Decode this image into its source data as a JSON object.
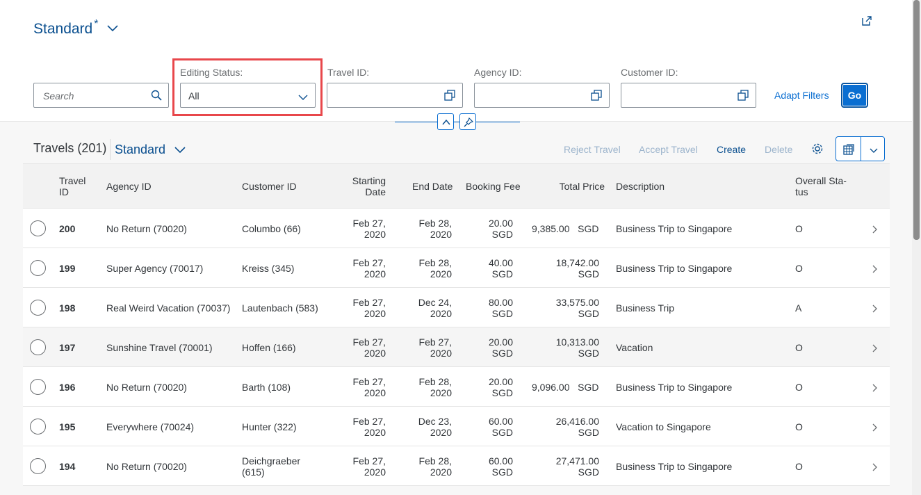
{
  "header": {
    "variant_title": "Standard",
    "variant_modified": "*",
    "search_placeholder": "Search",
    "filters": [
      {
        "label": "Editing Status:",
        "value": "All"
      },
      {
        "label": "Travel ID:",
        "value": ""
      },
      {
        "label": "Agency ID:",
        "value": ""
      },
      {
        "label": "Customer ID:",
        "value": ""
      }
    ],
    "adapt_filters": "Adapt Filters",
    "go": "Go"
  },
  "table": {
    "title": "Travels (201)",
    "variant": "Standard",
    "toolbar": {
      "reject": "Reject Travel",
      "accept": "Accept Travel",
      "create": "Create",
      "delete": "Delete"
    },
    "columns": {
      "travel_id": [
        "Travel",
        "ID"
      ],
      "agency_id": "Agency ID",
      "customer_id": "Customer ID",
      "start": [
        "Starting",
        "Date"
      ],
      "end": "End Date",
      "fee": "Booking Fee",
      "total": "Total Price",
      "desc": "Description",
      "status": [
        "Overall Sta-",
        "tus"
      ]
    },
    "rows": [
      {
        "id": "200",
        "agency": "No Return (70020)",
        "customer": [
          "Columbo (66)",
          ""
        ],
        "start": [
          "Feb 27,",
          "2020"
        ],
        "end": [
          "Feb 28,",
          "2020"
        ],
        "fee": [
          "20.00",
          "SGD"
        ],
        "total": [
          "9,385.00",
          "SGD"
        ],
        "desc": "Business Trip to Singapore",
        "status": "O"
      },
      {
        "id": "199",
        "agency": "Super Agency (70017)",
        "customer": [
          "Kreiss (345)",
          ""
        ],
        "start": [
          "Feb 27,",
          "2020"
        ],
        "end": [
          "Feb 28,",
          "2020"
        ],
        "fee": [
          "40.00",
          "SGD"
        ],
        "total": [
          "18,742.00",
          "SGD"
        ],
        "desc": "Business Trip to Singapore",
        "status": "O"
      },
      {
        "id": "198",
        "agency": "Real Weird Vacation (70037)",
        "customer": [
          "Lautenbach (583)",
          ""
        ],
        "start": [
          "Feb 27,",
          "2020"
        ],
        "end": [
          "Dec 24,",
          "2020"
        ],
        "fee": [
          "80.00",
          "SGD"
        ],
        "total": [
          "33,575.00",
          "SGD"
        ],
        "desc": "Business Trip",
        "status": "A"
      },
      {
        "id": "197",
        "agency": "Sunshine Travel (70001)",
        "customer": [
          "Hoffen (166)",
          ""
        ],
        "start": [
          "Feb 27,",
          "2020"
        ],
        "end": [
          "Feb 27,",
          "2020"
        ],
        "fee": [
          "20.00",
          "SGD"
        ],
        "total": [
          "10,313.00",
          "SGD"
        ],
        "desc": "Vacation",
        "status": "O"
      },
      {
        "id": "196",
        "agency": "No Return (70020)",
        "customer": [
          "Barth (108)",
          ""
        ],
        "start": [
          "Feb 27,",
          "2020"
        ],
        "end": [
          "Feb 28,",
          "2020"
        ],
        "fee": [
          "20.00",
          "SGD"
        ],
        "total": [
          "9,096.00",
          "SGD"
        ],
        "desc": "Business Trip to Singapore",
        "status": "O"
      },
      {
        "id": "195",
        "agency": "Everywhere (70024)",
        "customer": [
          "Hunter (322)",
          ""
        ],
        "start": [
          "Feb 27,",
          "2020"
        ],
        "end": [
          "Dec 23,",
          "2020"
        ],
        "fee": [
          "60.00",
          "SGD"
        ],
        "total": [
          "26,416.00",
          "SGD"
        ],
        "desc": "Vacation to Singapore",
        "status": "O"
      },
      {
        "id": "194",
        "agency": "No Return (70020)",
        "customer": [
          "Deichgraeber",
          "(615)"
        ],
        "start": [
          "Feb 27,",
          "2020"
        ],
        "end": [
          "Feb 28,",
          "2020"
        ],
        "fee": [
          "60.00",
          "SGD"
        ],
        "total": [
          "27,471.00",
          "SGD"
        ],
        "desc": "Business Trip to Singapore",
        "status": "O"
      }
    ]
  },
  "colors": {
    "accent": "#0a6ed1",
    "highlight_border": "#e8474b"
  },
  "icons": [
    "chevron-down-icon",
    "share-icon",
    "search-icon",
    "value-help-icon",
    "collapse-icon",
    "pin-icon",
    "settings-icon",
    "export-icon",
    "chevron-right-icon"
  ]
}
